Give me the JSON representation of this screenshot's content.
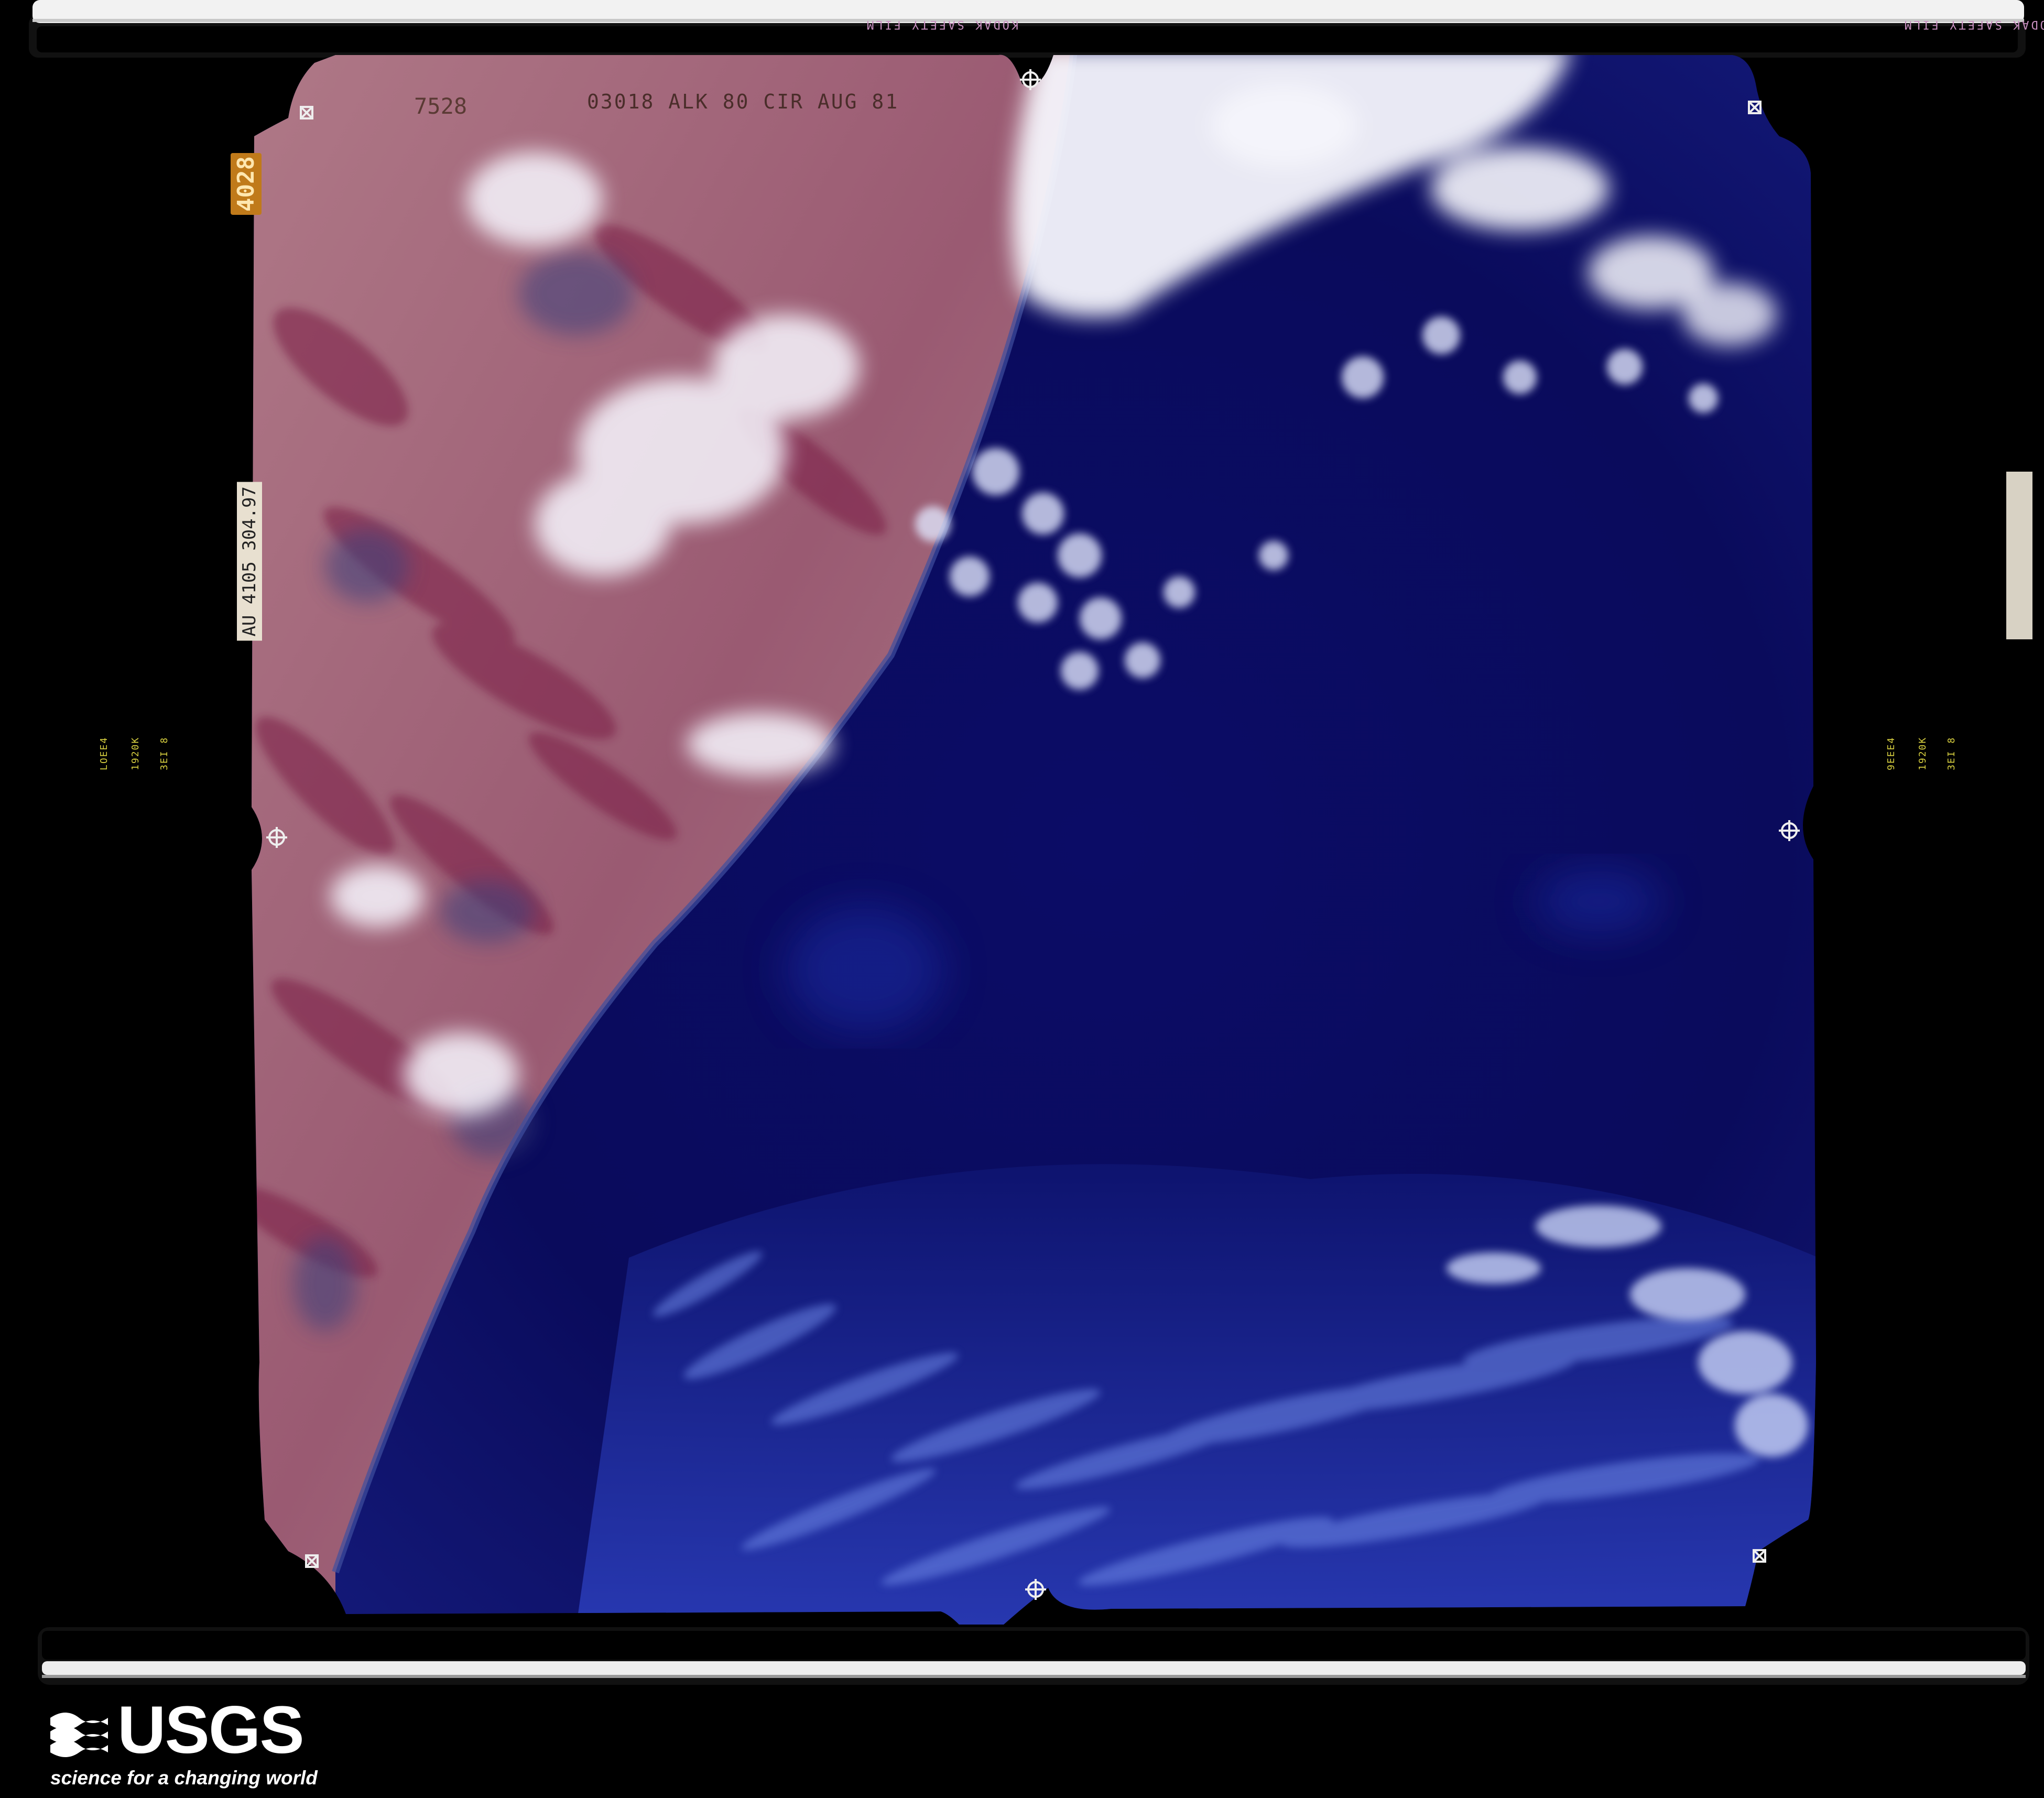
{
  "film": {
    "edge_top_left": "KODAK SAFETY FILM",
    "edge_top_right": "KODAK SAFETY FILM",
    "frame_label": "03018 ALK 80 CIR AUG 81",
    "frame_number": "7528",
    "counter": "4028",
    "serial": "AU 4105 304.97",
    "left_data": [
      "LOEE4",
      "1920K",
      "3EI 8"
    ],
    "right_data": [
      "9EEE4",
      "1920K",
      "3EI 8"
    ]
  },
  "logo": {
    "word": "USGS",
    "tagline": "science for a changing world"
  },
  "colors": {
    "ocean_deep": "#0a0b5c",
    "ocean_mid": "#1a2a9a",
    "land_pink": "#a2687a",
    "land_red": "#8c2a4e",
    "cloud_white": "#f2f2fa",
    "film_border": "#000000",
    "film_rail": "#f0f0f0"
  }
}
